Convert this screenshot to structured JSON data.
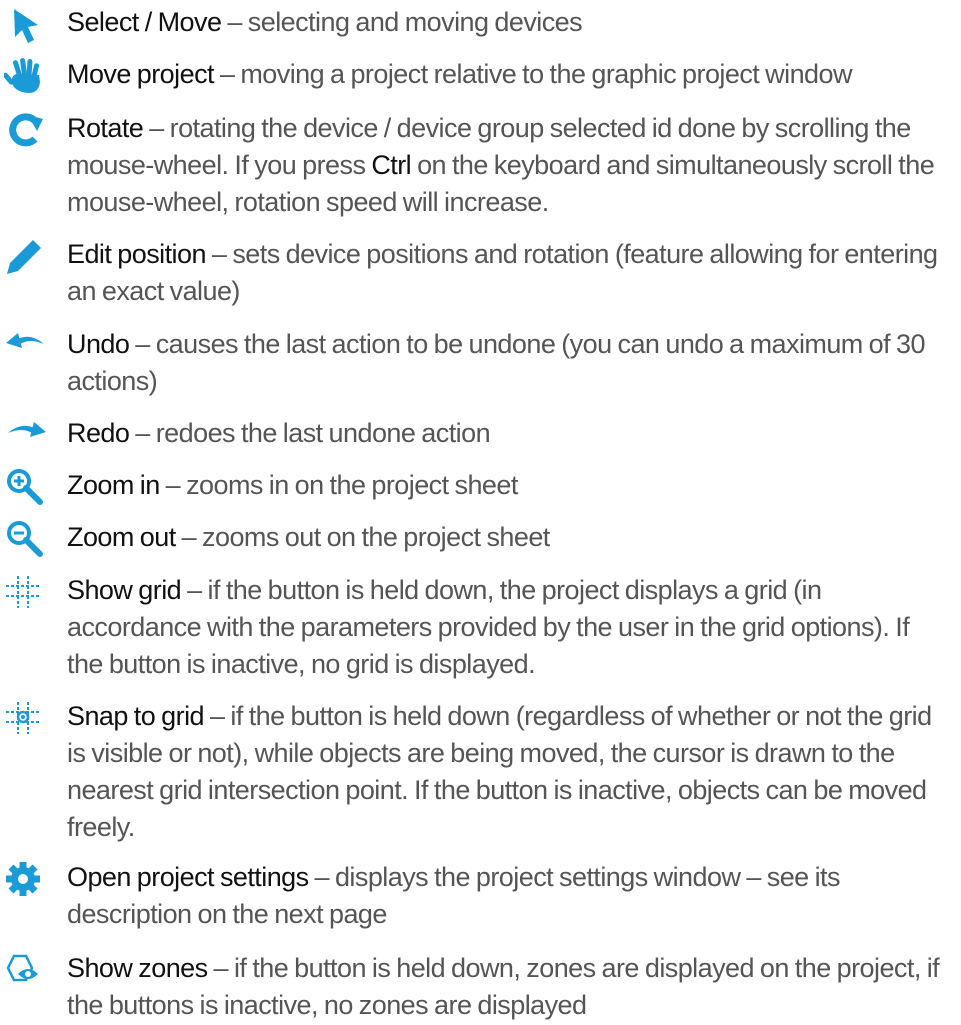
{
  "accent_color": "#1a9bd7",
  "items": [
    {
      "icon": "cursor-arrow-icon",
      "name": "Select / Move",
      "sep": " – ",
      "desc": "selecting and moving devices"
    },
    {
      "icon": "hand-icon",
      "name": "Move project",
      "sep": " – ",
      "desc": "moving a project relative to the graphic project window"
    },
    {
      "icon": "rotate-icon",
      "name": "Rotate",
      "sep": " – ",
      "desc_before": "rotating the device / device group selected id done by scrolling the mouse-wheel. If you press ",
      "key": "Ctrl",
      "desc_after": " on the keyboard and simultaneously scroll the mouse-wheel, rotation speed will increase."
    },
    {
      "icon": "pencil-icon",
      "name": "Edit position",
      "sep": " – ",
      "desc": "sets device positions and rotation (feature allowing for entering an exact value)"
    },
    {
      "icon": "undo-icon",
      "name": "Undo",
      "sep": " – ",
      "desc": "causes the last action to be undone (you can undo a maximum of 30 actions)"
    },
    {
      "icon": "redo-icon",
      "name": "Redo",
      "sep": " – ",
      "desc": "redoes the last undone action"
    },
    {
      "icon": "zoom-in-icon",
      "name": "Zoom in",
      "sep": " – ",
      "desc": "zooms in on the project sheet"
    },
    {
      "icon": "zoom-out-icon",
      "name": "Zoom out",
      "sep": " – ",
      "desc": "zooms out on the project sheet"
    },
    {
      "icon": "grid-icon",
      "name": "Show grid",
      "sep": " – ",
      "desc": "if the button is held down, the project displays a grid (in accordance with the parameters provided by the user in the grid options). If the button is inactive, no grid is displayed."
    },
    {
      "icon": "snap-to-grid-icon",
      "name": "Snap to grid",
      "sep": " – ",
      "desc": "if the button is held down (regardless of whether or not the grid is visible or not), while objects are being moved, the cursor is drawn to the nearest grid intersection point. If the button is inactive, objects can be moved freely."
    },
    {
      "icon": "gear-icon",
      "name": "Open project settings",
      "sep": " – ",
      "desc": "displays the project settings window – see its description on the next page"
    },
    {
      "icon": "zones-eye-icon",
      "name": "Show zones",
      "sep": " – ",
      "desc": "if the button is held down, zones are displayed on the project, if the buttons is inactive, no zones are displayed"
    }
  ]
}
